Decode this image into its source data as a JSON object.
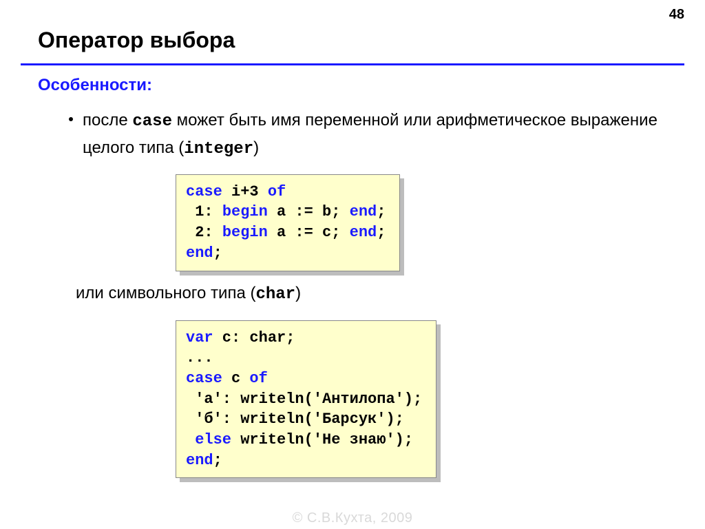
{
  "page_number": "48",
  "title": "Оператор выбора",
  "section_label": "Особенности:",
  "bullet": {
    "prefix": "после ",
    "kw_case": "case",
    "mid": " может быть имя переменной или арифметическое выражение целого типа (",
    "kw_integer": "integer",
    "suffix": ")"
  },
  "code1": {
    "l1a": "case",
    "l1b": " i+3 ",
    "l1c": "of",
    "l2a": " 1: ",
    "l2b": "begin",
    "l2c": " a := b; ",
    "l2d": "end",
    "l2e": ";",
    "l3a": " 2: ",
    "l3b": "begin",
    "l3c": " a := c; ",
    "l3d": "end",
    "l3e": ";",
    "l4a": "end",
    "l4b": ";"
  },
  "subtext": {
    "prefix": "или символьного типа (",
    "kw_char": "char",
    "suffix": ")"
  },
  "code2": {
    "l1a": "var",
    "l1b": " c: char;",
    "l2": "...",
    "l3a": "case",
    "l3b": " c ",
    "l3c": "of",
    "l4": " 'а': writeln('Антилопа');",
    "l5": " 'б': writeln('Барсук');",
    "l6a": " ",
    "l6b": "else",
    "l6c": " writeln('Не знаю');",
    "l7a": "end",
    "l7b": ";"
  },
  "footer": "© С.В.Кухта, 2009"
}
